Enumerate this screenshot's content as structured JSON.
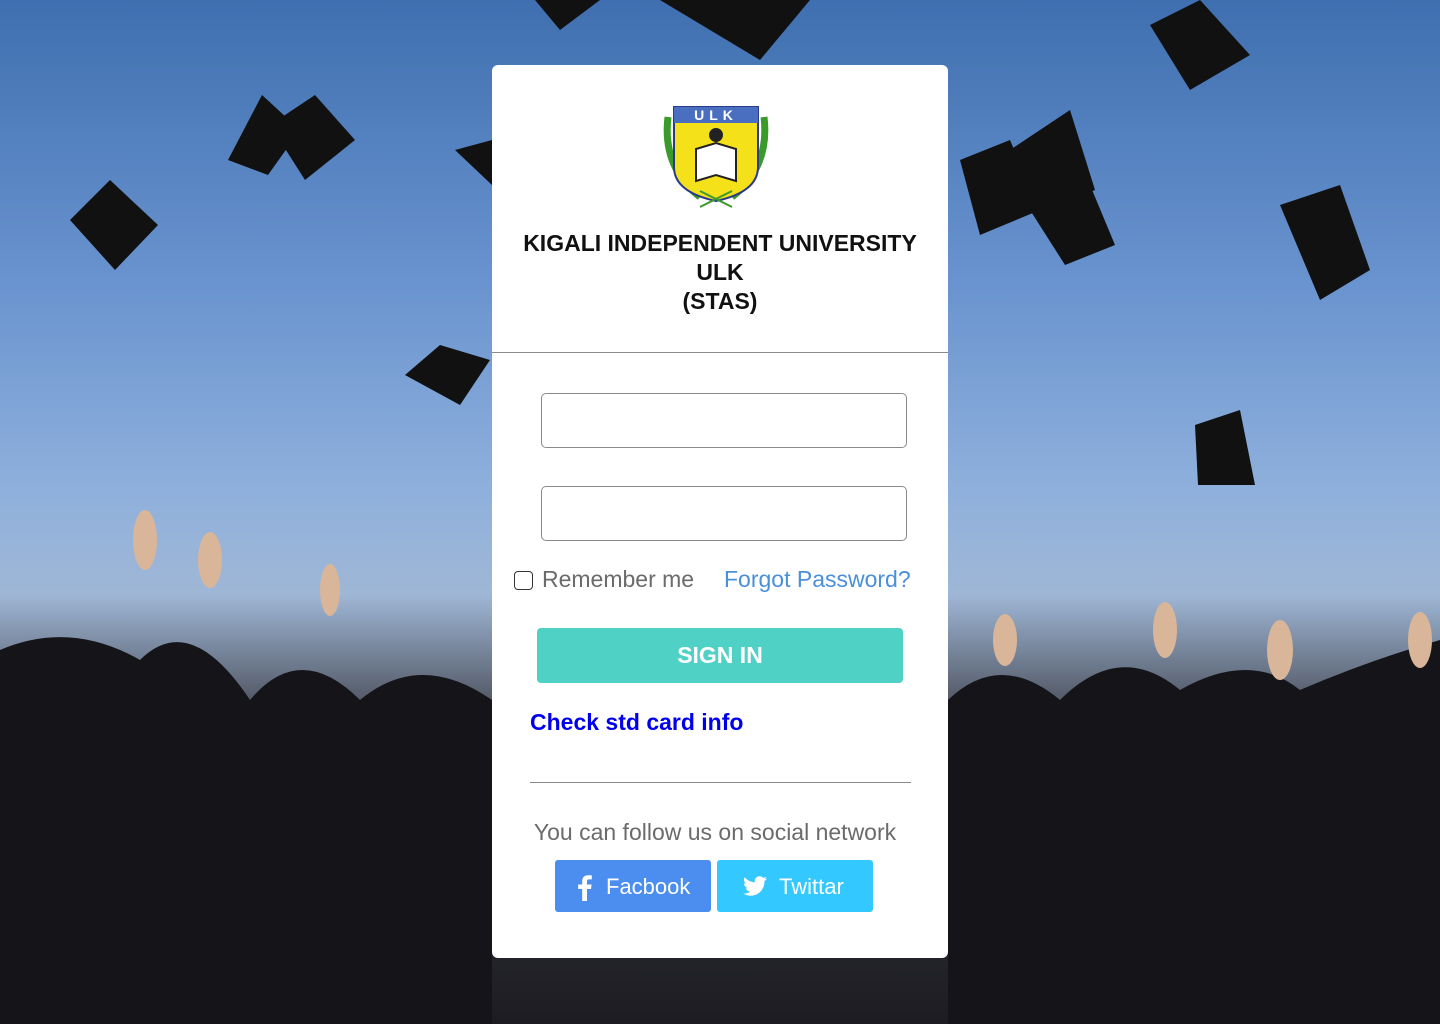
{
  "colors": {
    "sky": "#6a94cf",
    "signin_button": "#4fd1c5",
    "forgot_link": "#4a90d9",
    "card_info_link": "#0000ee",
    "facebook": "#4c8ef0",
    "twitter": "#33c8ff"
  },
  "background": {
    "icon": "graduation-cap-icon"
  },
  "logo": {
    "icon": "university-crest-icon",
    "text": "ULK"
  },
  "header": {
    "line1": "KIGALI INDEPENDENT UNIVERSITY",
    "line2": "ULK",
    "line3": "(STAS)"
  },
  "form": {
    "username": {
      "value": "",
      "placeholder": ""
    },
    "password": {
      "value": "",
      "placeholder": ""
    },
    "remember_label": "Remember me",
    "remember_checked": false,
    "forgot_label": "Forgot Password?",
    "signin_label": "SIGN IN",
    "card_info_label": "Check std card info"
  },
  "social": {
    "heading": "You can follow us on social network",
    "facebook": {
      "label": "Facbook",
      "icon": "facebook-icon"
    },
    "twitter": {
      "label": "Twittar",
      "icon": "twitter-icon"
    }
  }
}
